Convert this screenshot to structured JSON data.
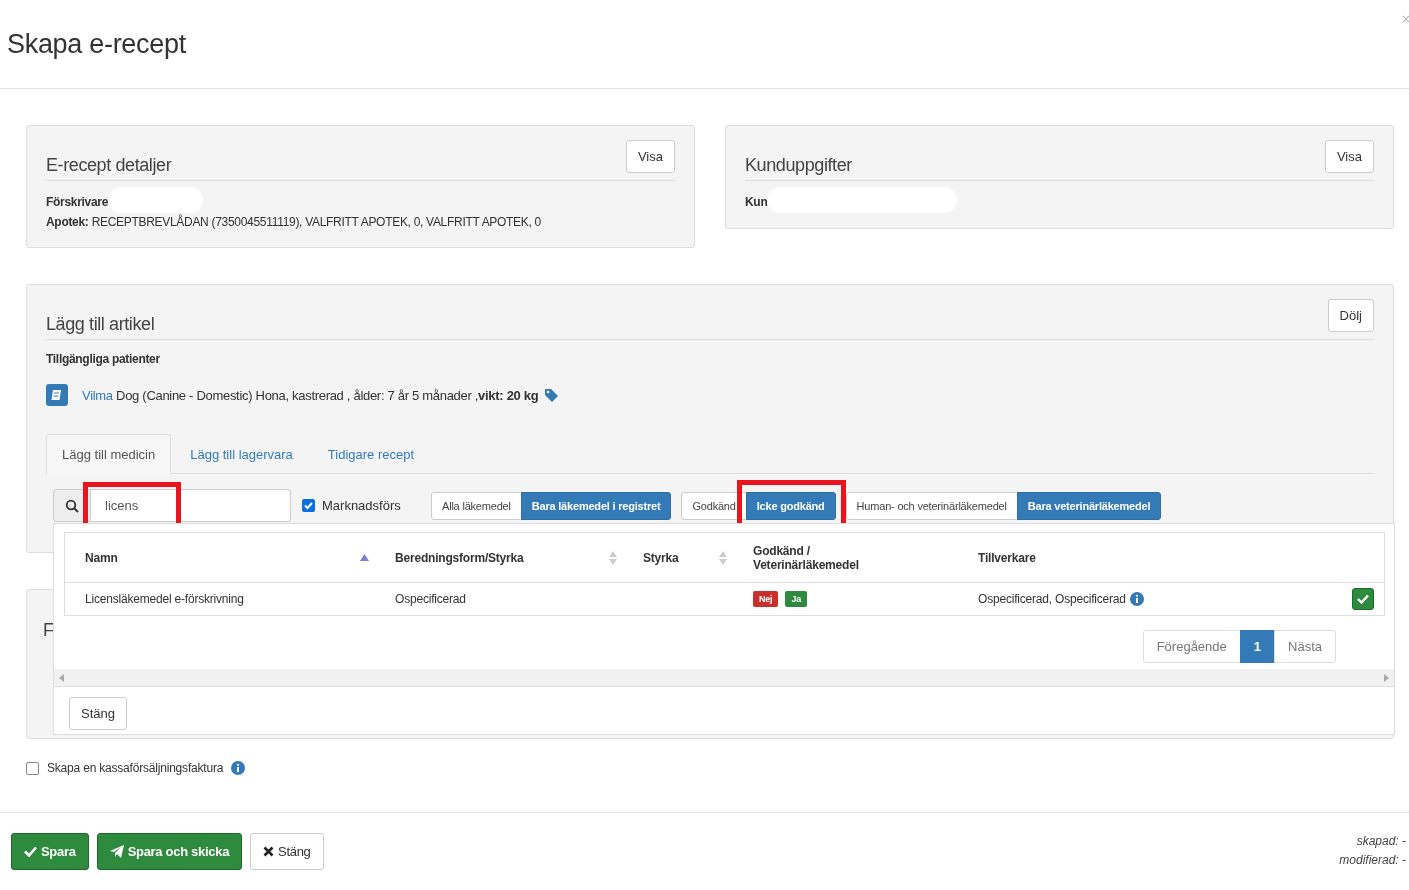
{
  "page": {
    "title": "Skapa e-recept"
  },
  "details_panel": {
    "title": "E-recept detaljer",
    "button": "Visa",
    "prescriber_label": "Förskrivare",
    "pharmacy_label": "Apotek:",
    "pharmacy_value": "RECEPTBREVLÅDAN (7350045511119), VALFRITT APOTEK, 0, VALFRITT APOTEK, 0"
  },
  "customer_panel": {
    "title": "Kunduppgifter",
    "button": "Visa",
    "customer_label": "Kun"
  },
  "article_panel": {
    "title": "Lägg till artikel",
    "button": "Dölj",
    "patients_heading": "Tillgängliga patienter",
    "patient": {
      "name": "Vilma",
      "details": "Dog (Canine - Domestic) Hona, kastrerad , ålder: 7 år 5 månader ,**vikt: 20 kg**"
    },
    "tabs": [
      {
        "label": "Lägg till medicin",
        "selected": true
      },
      {
        "label": "Lägg till lagervara",
        "selected": false
      },
      {
        "label": "Tidigare recept",
        "selected": false
      }
    ],
    "search": {
      "value": "licens",
      "highlighted": true
    },
    "marketed": {
      "label": "Marknadsförs",
      "checked": true
    },
    "filter_groups": [
      [
        {
          "label": "Alla läkemedel",
          "selected": false,
          "highlighted": false
        },
        {
          "label": "Bara läkemedel i registret",
          "selected": true,
          "highlighted": false
        }
      ],
      [
        {
          "label": "Godkänd",
          "selected": false,
          "highlighted": false
        },
        {
          "label": "Icke godkänd",
          "selected": true,
          "highlighted": true
        }
      ],
      [
        {
          "label": "Human- och veterinärläkemedel",
          "selected": false,
          "highlighted": false
        },
        {
          "label": "Bara veterinärläkemedel",
          "selected": true,
          "highlighted": false
        }
      ]
    ]
  },
  "results": {
    "columns": [
      {
        "label": "Namn",
        "sorted": true
      },
      {
        "label": "Beredningsform/Styrka",
        "sortable": true,
        "sorted": false
      },
      {
        "label": "Styrka",
        "sortable": true,
        "sorted": false
      },
      {
        "label": "Godkänd / Veterinärläkemedel",
        "sortable": false
      },
      {
        "label": "Tillverkare",
        "sortable": false
      }
    ],
    "rows": [
      {
        "name": "Licensläkemedel e-förskrivning",
        "form": "Ospecificerad",
        "badges": [
          {
            "label": "Nej",
            "color": "#c9302c"
          },
          {
            "label": "Ja",
            "color": "#2e8b3e"
          }
        ],
        "manufacturer": "Ospecificerad, Ospecificerad"
      }
    ],
    "pagination": {
      "previous": "Föregående",
      "pages": [
        {
          "label": "1",
          "selected": true
        }
      ],
      "next": "Nästa"
    },
    "close_button": "Stäng"
  },
  "hidden_panel": {
    "title": "F"
  },
  "invoice": {
    "label": "Skapa en kassaförsäljningsfaktura",
    "checked": false
  },
  "footer": {
    "buttons": [
      {
        "label": "Spara",
        "kind": "save"
      },
      {
        "label": "Spara och skicka",
        "kind": "send"
      },
      {
        "label": "Stäng",
        "kind": "close"
      }
    ],
    "meta": [
      "skapad: -",
      "modifierad: -"
    ]
  }
}
